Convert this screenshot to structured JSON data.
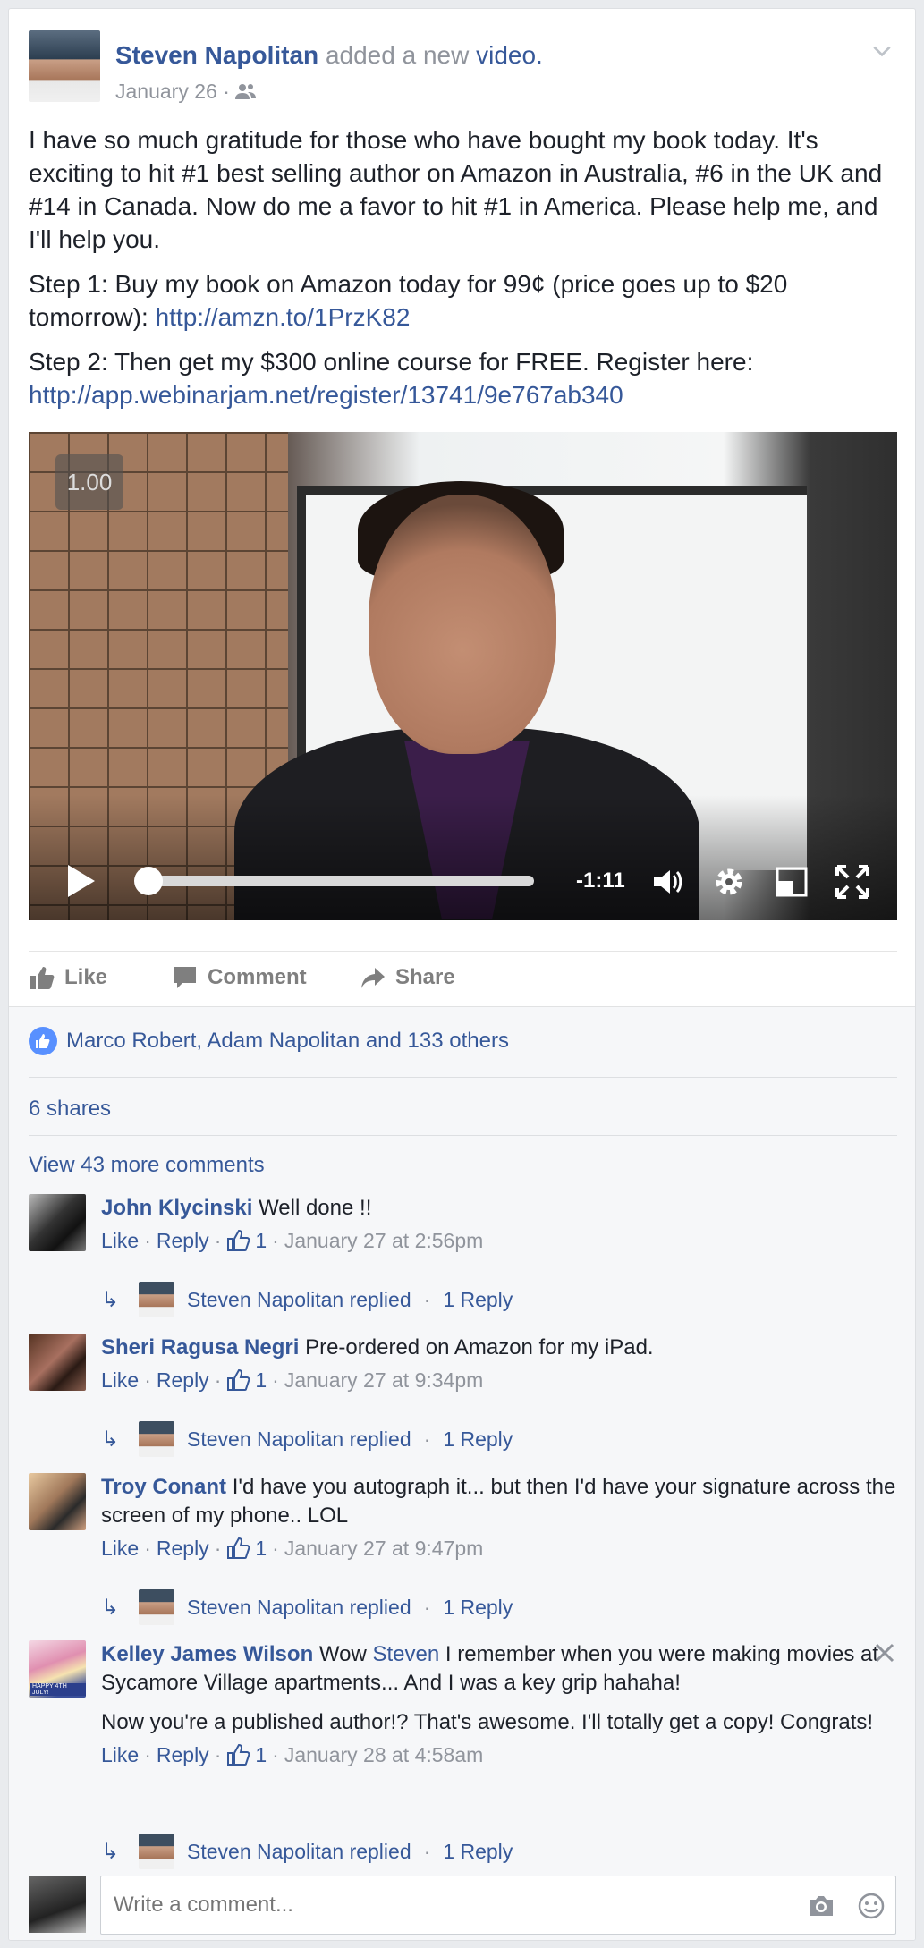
{
  "post": {
    "author": "Steven Napolitan",
    "action_text": "added a new",
    "action_link": "video.",
    "date": "January 26 ·",
    "icons": {
      "audience": "friends-icon",
      "menu": "chevron-down-icon"
    },
    "paragraphs": [
      {
        "text": "I have so much gratitude for those who have bought my book today. It's exciting to hit #1 best selling author on Amazon in Australia, #6 in the UK and #14 in Canada. Now do me a favor to hit #1 in America. Please help me, and I'll help you."
      },
      {
        "text": "Step 1: Buy my book on Amazon today for 99¢ (price goes up to $20 tomorrow): ",
        "link": "http://amzn.to/1PrzK82"
      },
      {
        "text": "Step 2: Then get my $300 online course for FREE. Register here: ",
        "link": "http://app.webinarjam.net/register/13741/9e767ab340"
      }
    ]
  },
  "video": {
    "speed": "1.00",
    "time_remaining": "-1:11",
    "progress": 0.0,
    "icons": [
      "play-icon",
      "volume-icon",
      "gear-icon",
      "pip-icon",
      "fullscreen-icon"
    ]
  },
  "actions": {
    "like": "Like",
    "comment": "Comment",
    "share": "Share"
  },
  "feedback": {
    "likes_text": "Marco Robert, Adam Napolitan and 133 others",
    "shares_text": "6 shares",
    "view_more": "View 43 more comments"
  },
  "comments": [
    {
      "author": "John Klycinski",
      "text": "Well done !!",
      "like": "Like",
      "reply": "Reply",
      "likes": "1",
      "time": "January 27 at 2:56pm",
      "replied_by": "Steven Napolitan replied",
      "reply_count": "1 Reply"
    },
    {
      "author": "Sheri Ragusa Negri",
      "text": "Pre-ordered on Amazon for my iPad.",
      "like": "Like",
      "reply": "Reply",
      "likes": "1",
      "time": "January 27 at 9:34pm",
      "replied_by": "Steven Napolitan replied",
      "reply_count": "1 Reply"
    },
    {
      "author": "Troy Conant",
      "text": "I'd have you autograph it... but then I'd have your signature across the screen of my phone.. LOL",
      "like": "Like",
      "reply": "Reply",
      "likes": "1",
      "time": "January 27 at 9:47pm",
      "replied_by": "Steven Napolitan replied",
      "reply_count": "1 Reply"
    },
    {
      "author": "Kelley James Wilson",
      "text_pre": "Wow ",
      "mention": "Steven",
      "text": " I remember when you were making movies at Sycamore Village apartments... And I was a key grip hahaha!",
      "text2": "Now you're a published author!? That's awesome. I'll totally get a copy! Congrats!",
      "like": "Like",
      "reply": "Reply",
      "likes": "1",
      "time": "January 28 at 4:58am",
      "replied_by": "Steven Napolitan replied",
      "reply_count": "1 Reply",
      "avatar_caption": "HAPPY 4TH JULY!"
    }
  ],
  "composer": {
    "placeholder": "Write a comment...",
    "icons": [
      "camera-icon",
      "emoji-icon"
    ]
  },
  "colors": {
    "link": "#365899",
    "muted": "#90949c",
    "like_blue": "#5890ff"
  }
}
